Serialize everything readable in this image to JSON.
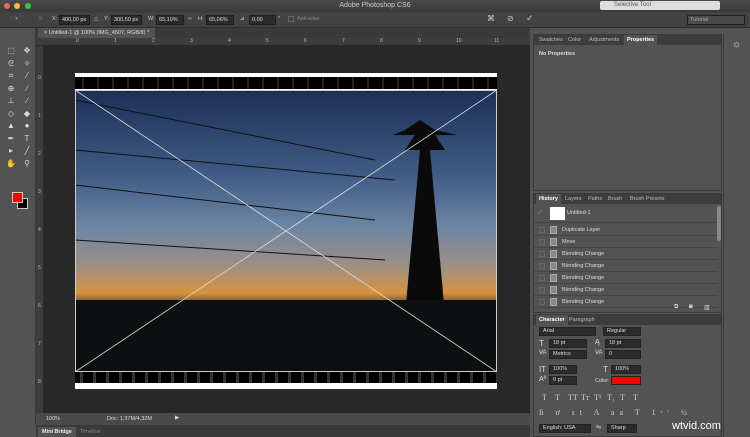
{
  "app": {
    "title": "Adobe Photoshop CS6",
    "floating_tool": "Selective Tool",
    "workspace": "Tutorial"
  },
  "options": {
    "x_label": "X:",
    "x": "400,00 px",
    "y_label": "Y:",
    "y": "300,50 px",
    "w_label": "W:",
    "w": "65,10%",
    "h_label": "H:",
    "h": "65,06%",
    "angle": "0,00",
    "angle_unit": "°",
    "antialias": "Anti-alias"
  },
  "document": {
    "tab": "Untitled-1 @ 100% (IMG_4507, RGB/8) *",
    "zoom": "100%",
    "doc_size": "Doc: 1,37M/4,32M"
  },
  "rulers": {
    "h": [
      "0",
      "1",
      "2",
      "3",
      "4",
      "5",
      "6",
      "7",
      "8",
      "9",
      "10",
      "11"
    ],
    "v": [
      "0",
      "1",
      "2",
      "3",
      "4",
      "5",
      "6",
      "7",
      "8"
    ]
  },
  "bottom_tabs": [
    "Mini Bridge",
    "Timeline"
  ],
  "properties": {
    "tabs": [
      "Swatches",
      "Color",
      "Adjustments",
      "Properties"
    ],
    "content": "No Properties"
  },
  "history": {
    "tabs": [
      "History",
      "Layers",
      "Paths",
      "Brush",
      "Brush Presets"
    ],
    "snapshot": "Untitled-1",
    "items": [
      "Duplicate Layer",
      "Move",
      "Blending Change",
      "Blending Change",
      "Blending Change",
      "Blending Change",
      "Blending Change"
    ]
  },
  "character": {
    "tabs": [
      "Character",
      "Paragraph"
    ],
    "font": "Arial",
    "style": "Regular",
    "size": "18 pt",
    "leading": "18 pt",
    "kerning": "Metrics",
    "tracking": "0",
    "vscale": "100%",
    "hscale": "100%",
    "baseline": "0 pt",
    "color_label": "Color:",
    "color": "#ff0000",
    "language": "English: USA",
    "antialias": "Sharp",
    "type_styles": [
      "T",
      "T",
      "TT",
      "Tт",
      "T¹",
      "T₁",
      "T",
      "T"
    ]
  },
  "watermark": "wtvid.com"
}
